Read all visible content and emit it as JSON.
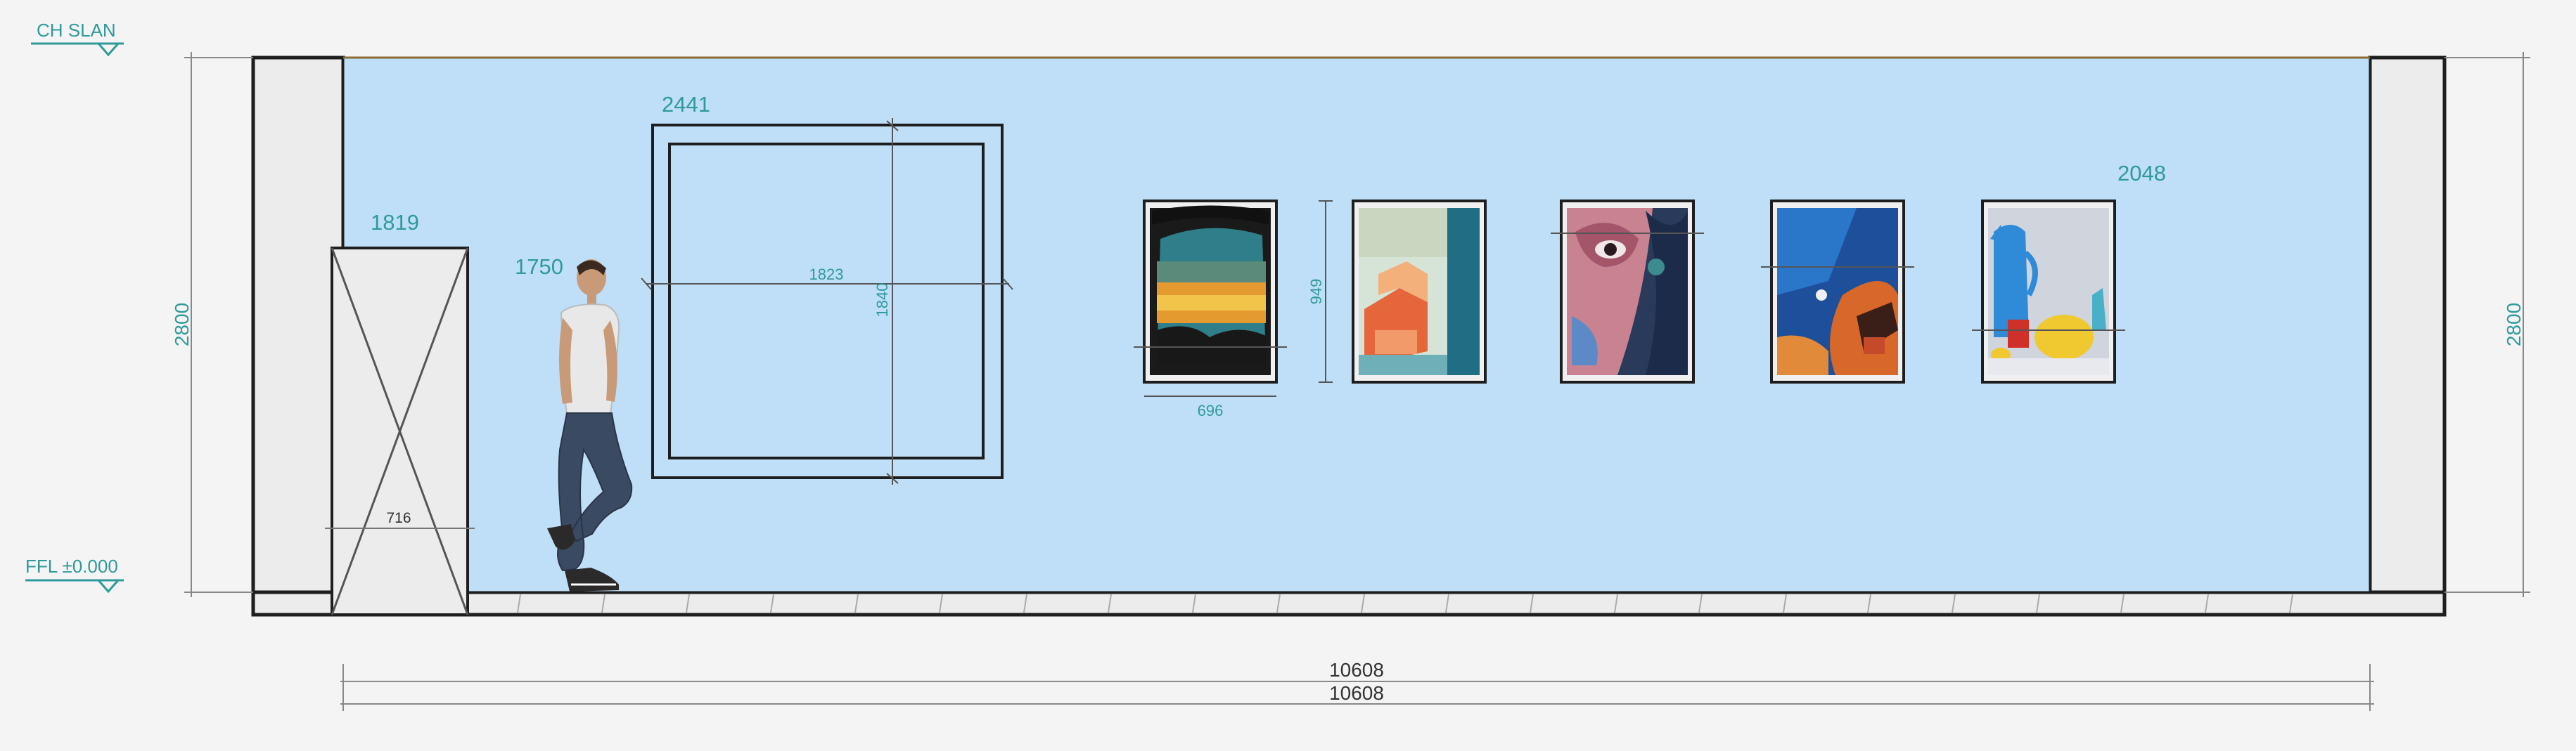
{
  "levels": {
    "ceiling": "CH SLAN",
    "floor": "FFL ±0.000"
  },
  "dimensions": {
    "wall_height_left": "2800",
    "wall_height_right": "2800",
    "door_height": "1819",
    "door_width": "716",
    "figure_height": "1750",
    "large_frame_top": "2441",
    "large_frame_width": "1823",
    "large_frame_height": "1840",
    "painting_width": "696",
    "painting_height": "949",
    "paintings_top": "2048",
    "overall_length_1": "10608",
    "overall_length_2": "10608"
  },
  "paintings": [
    {
      "subject": "sunset-landscape"
    },
    {
      "subject": "architecture-abstract"
    },
    {
      "subject": "face-portrait"
    },
    {
      "subject": "abstract-figure"
    },
    {
      "subject": "still-life-teapot"
    }
  ],
  "colors": {
    "wall": "#bfdff8",
    "side_wall": "#ececec",
    "outline": "#1e1e1e",
    "annotation": "#2f9a9a"
  }
}
